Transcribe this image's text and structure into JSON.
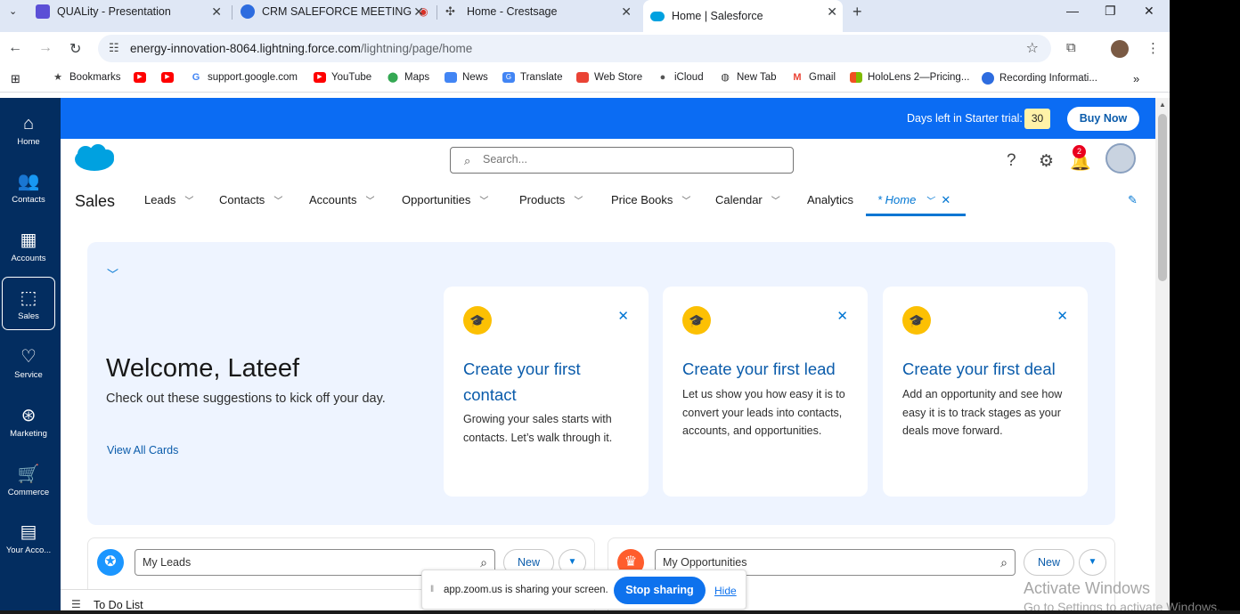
{
  "browser": {
    "tabs": [
      {
        "title": "QUALity - Presentation",
        "color": "#5b4fd6"
      },
      {
        "title": "CRM SALEFORCE MEETING",
        "color": "#2d6cdf"
      },
      {
        "title": "Home - Crestsage",
        "color": "#444"
      },
      {
        "title": "Home | Salesforce",
        "color": "#00a1e0"
      }
    ],
    "url_host": "energy-innovation-8064.lightning.force.com",
    "url_path": "/lightning/page/home",
    "bookmarks": [
      {
        "label": "Bookmarks",
        "icon": "star-icon"
      },
      {
        "label": "",
        "icon": "youtube-icon"
      },
      {
        "label": "",
        "icon": "youtube-icon"
      },
      {
        "label": "support.google.com",
        "icon": "google-icon"
      },
      {
        "label": "YouTube",
        "icon": "youtube-icon"
      },
      {
        "label": "Maps",
        "icon": "maps-icon"
      },
      {
        "label": "News",
        "icon": "news-icon"
      },
      {
        "label": "Translate",
        "icon": "translate-icon"
      },
      {
        "label": "Web Store",
        "icon": "webstore-icon"
      },
      {
        "label": "iCloud",
        "icon": "apple-icon"
      },
      {
        "label": "New Tab",
        "icon": "globe-icon"
      },
      {
        "label": "Gmail",
        "icon": "gmail-icon"
      },
      {
        "label": "HoloLens 2—Pricing...",
        "icon": "windows-icon"
      },
      {
        "label": "Recording Informati...",
        "icon": "zoom-icon"
      }
    ]
  },
  "rail": [
    {
      "label": "Home",
      "icon": "home-icon"
    },
    {
      "label": "Contacts",
      "icon": "contacts-icon"
    },
    {
      "label": "Accounts",
      "icon": "accounts-icon"
    },
    {
      "label": "Sales",
      "icon": "sales-icon"
    },
    {
      "label": "Service",
      "icon": "heart-icon"
    },
    {
      "label": "Marketing",
      "icon": "marketing-icon"
    },
    {
      "label": "Commerce",
      "icon": "cart-icon"
    },
    {
      "label": "Your Acco...",
      "icon": "building-icon"
    }
  ],
  "trial": {
    "text": "Days left in Starter trial:",
    "days": "30",
    "buy": "Buy Now"
  },
  "header": {
    "search_placeholder": "Search...",
    "notifications": "2"
  },
  "nav": {
    "app_name": "Sales",
    "tabs": [
      "Leads",
      "Contacts",
      "Accounts",
      "Opportunities",
      "Products",
      "Price Books",
      "Calendar",
      "Analytics"
    ],
    "active_tab": "* Home"
  },
  "welcome": {
    "title": "Welcome, Lateef",
    "subtitle": "Check out these suggestions to kick off your day.",
    "view_all": "View All Cards"
  },
  "cards": [
    {
      "title": "Create your first contact",
      "desc": "Growing your sales starts with contacts. Let’s walk through it."
    },
    {
      "title": "Create your first lead",
      "desc": "Let us show you how easy it is to convert your leads into contacts, accounts, and opportunities."
    },
    {
      "title": "Create your first deal",
      "desc": "Add an opportunity and see how easy it is to track stages as your deals move forward."
    }
  ],
  "widgets": [
    {
      "list": "My Leads",
      "new": "New",
      "color": "#1b96ff"
    },
    {
      "list": "My Opportunities",
      "new": "New",
      "color": "#ff5d2d"
    }
  ],
  "todo": "To Do List",
  "zoom": {
    "message": "app.zoom.us is sharing your screen.",
    "stop": "Stop sharing",
    "hide": "Hide"
  },
  "watermark": {
    "line1": "Activate Windows",
    "line2": "Go to Settings to activate Windows."
  }
}
